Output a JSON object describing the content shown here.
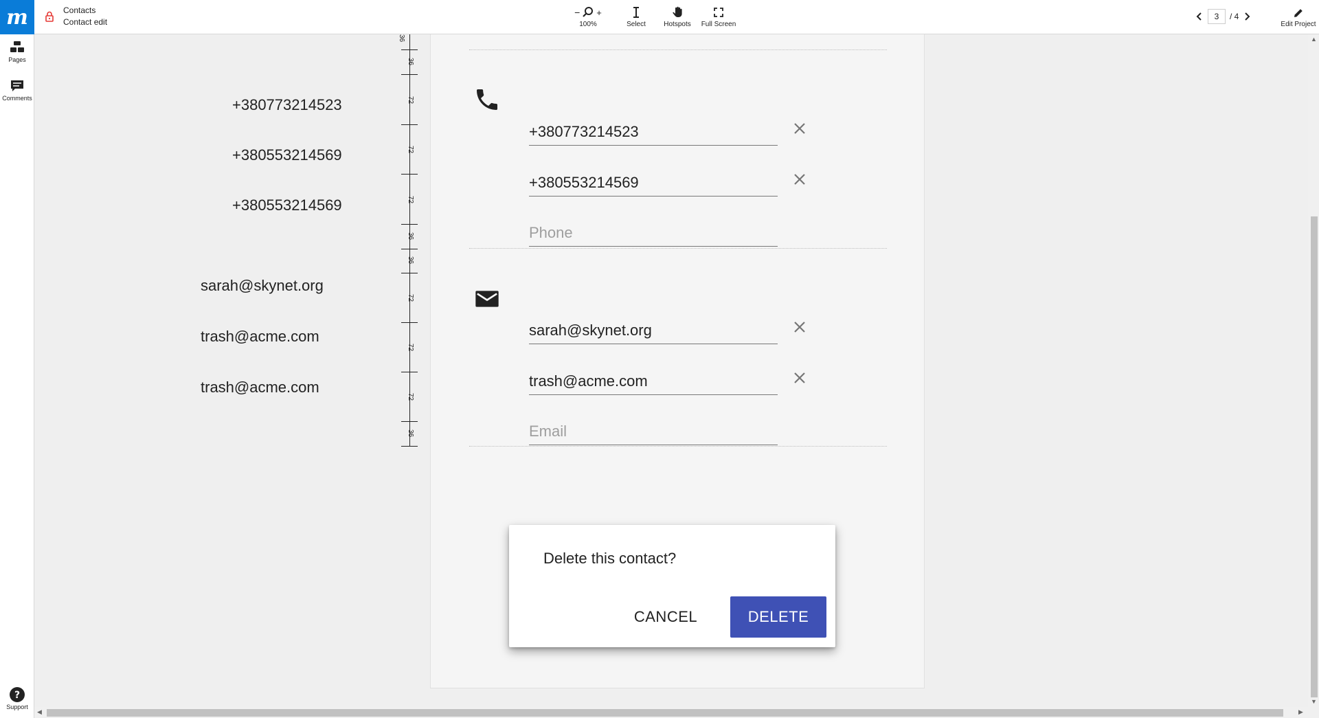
{
  "topbar": {
    "logo": "m",
    "breadcrumb_project": "Contacts",
    "breadcrumb_page": "Contact edit",
    "zoom_label": "100%",
    "zoom_minus": "−",
    "zoom_plus": "+",
    "select_label": "Select",
    "hotspots_label": "Hotspots",
    "fullscreen_label": "Full Screen",
    "page_current": "3",
    "page_total": "/ 4",
    "edit_project_label": "Edit Project"
  },
  "sidebar": {
    "pages_label": "Pages",
    "comments_label": "Comments",
    "support_label": "Support"
  },
  "left_labels": {
    "phones": [
      "+380773214523",
      "+380553214569",
      "+380553214569"
    ],
    "emails": [
      "sarah@skynet.org",
      "trash@acme.com",
      "trash@acme.com"
    ]
  },
  "ruler": {
    "labels": [
      "36",
      "36",
      "72",
      "72",
      "72",
      "36",
      "36",
      "72",
      "72",
      "72",
      "36"
    ]
  },
  "form": {
    "phones": [
      "+380773214523",
      "+380553214569"
    ],
    "phone_placeholder": "Phone",
    "emails": [
      "sarah@skynet.org",
      "trash@acme.com"
    ],
    "email_placeholder": "Email"
  },
  "dialog": {
    "title": "Delete this contact?",
    "cancel_label": "CANCEL",
    "delete_label": "DELETE",
    "accent_color": "#3f51b5"
  }
}
